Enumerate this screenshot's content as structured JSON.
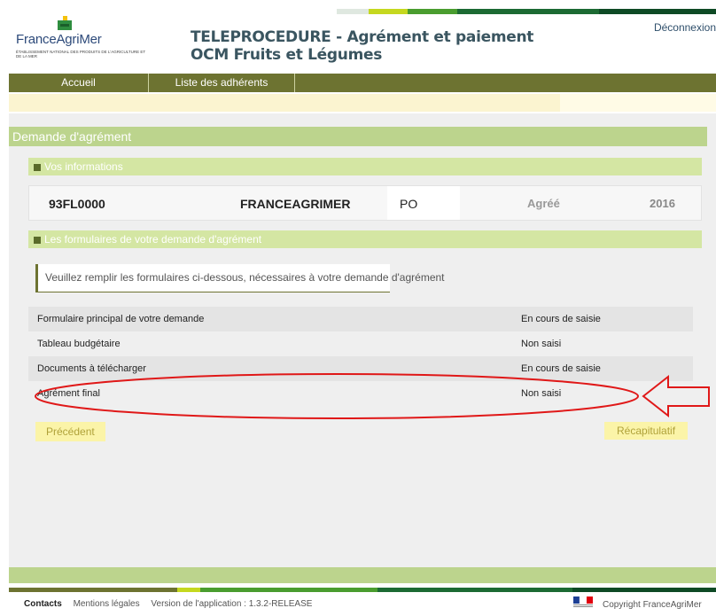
{
  "header": {
    "logo_text": "FranceAgriMer",
    "logo_subtitle": "ÉTABLISSEMENT NATIONAL DES PRODUITS DE L'AGRICULTURE ET DE LA MER",
    "title_line1": "TELEPROCEDURE - Agrément et paiement",
    "title_line2": "OCM Fruits et Légumes",
    "logout_label": "Déconnexion"
  },
  "nav": {
    "items": [
      {
        "label": "Accueil"
      },
      {
        "label": "Liste des adhérents"
      }
    ]
  },
  "page": {
    "title": "Demande d'agrément"
  },
  "sections": {
    "info_title": "Vos informations",
    "forms_title": "Les formulaires de votre demande d'agrément"
  },
  "info": {
    "code": "93FL0000",
    "name": "FRANCEAGRIMER",
    "type": "PO",
    "status": "Agréé",
    "year": "2016"
  },
  "instruction": "Veuillez remplir les formulaires ci-dessous, nécessaires à votre demande d'agrément",
  "forms": [
    {
      "label": "Formulaire principal de votre demande",
      "status": "En cours de saisie"
    },
    {
      "label": "Tableau budgétaire",
      "status": "Non saisi"
    },
    {
      "label": "Documents à télécharger",
      "status": "En cours de saisie"
    },
    {
      "label": "Agrément final",
      "status": "Non saisi"
    }
  ],
  "buttons": {
    "previous": "Précédent",
    "summary": "Récapitulatif"
  },
  "footer": {
    "contacts": "Contacts",
    "legal": "Mentions légales",
    "version": "Version de l'application : 1.3.2-RELEASE",
    "copyright": "Copyright FranceAgriMer"
  },
  "colors": {
    "nav_bg": "#6d7331",
    "section_bg": "#d4e6a3",
    "title_bg": "#bcd48d",
    "annotation": "#e01818"
  }
}
